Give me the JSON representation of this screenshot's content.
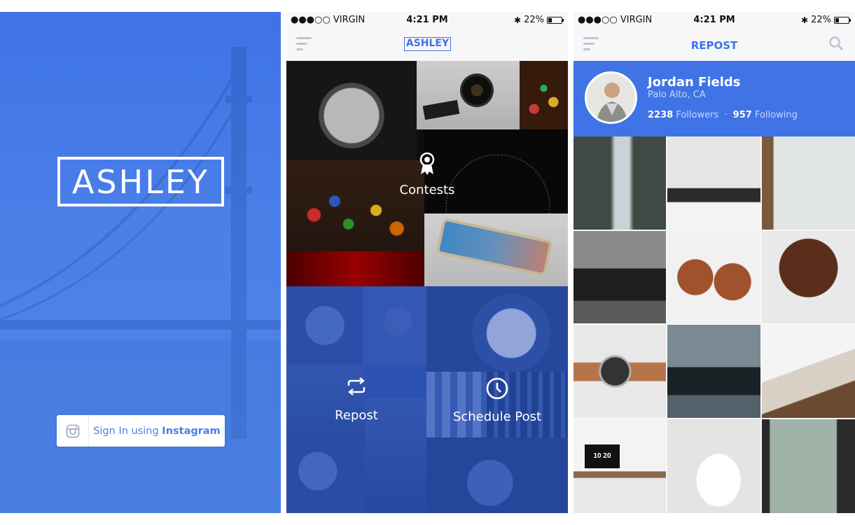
{
  "signin_screen": {
    "logo": "ASHLEY",
    "button_prefix": "Sign In using ",
    "button_brand": "Instagram",
    "icon": "instagram-icon"
  },
  "status_bar": {
    "carrier": "●●●○○ VIRGIN",
    "time": "4:21 PM",
    "battery": "22%"
  },
  "dashboard_screen": {
    "logo": "ASHLEY",
    "tiles": [
      {
        "label": "Contests",
        "icon": "ribbon-award-icon"
      },
      {
        "label": "Repost",
        "icon": "repost-arrows-icon"
      },
      {
        "label": "Schedule Post",
        "icon": "clock-icon"
      }
    ]
  },
  "profile_screen": {
    "title": "REPOST",
    "name": "Jordan Fields",
    "location": "Palo Alto, CA",
    "followers_count": "2238",
    "followers_label": "Followers",
    "separator": "·",
    "following_count": "957",
    "following_label": "Following",
    "photo_caption": "10 20"
  },
  "colors": {
    "brand_blue": "#3f73e6",
    "nav_bg": "#f7f7f8"
  }
}
